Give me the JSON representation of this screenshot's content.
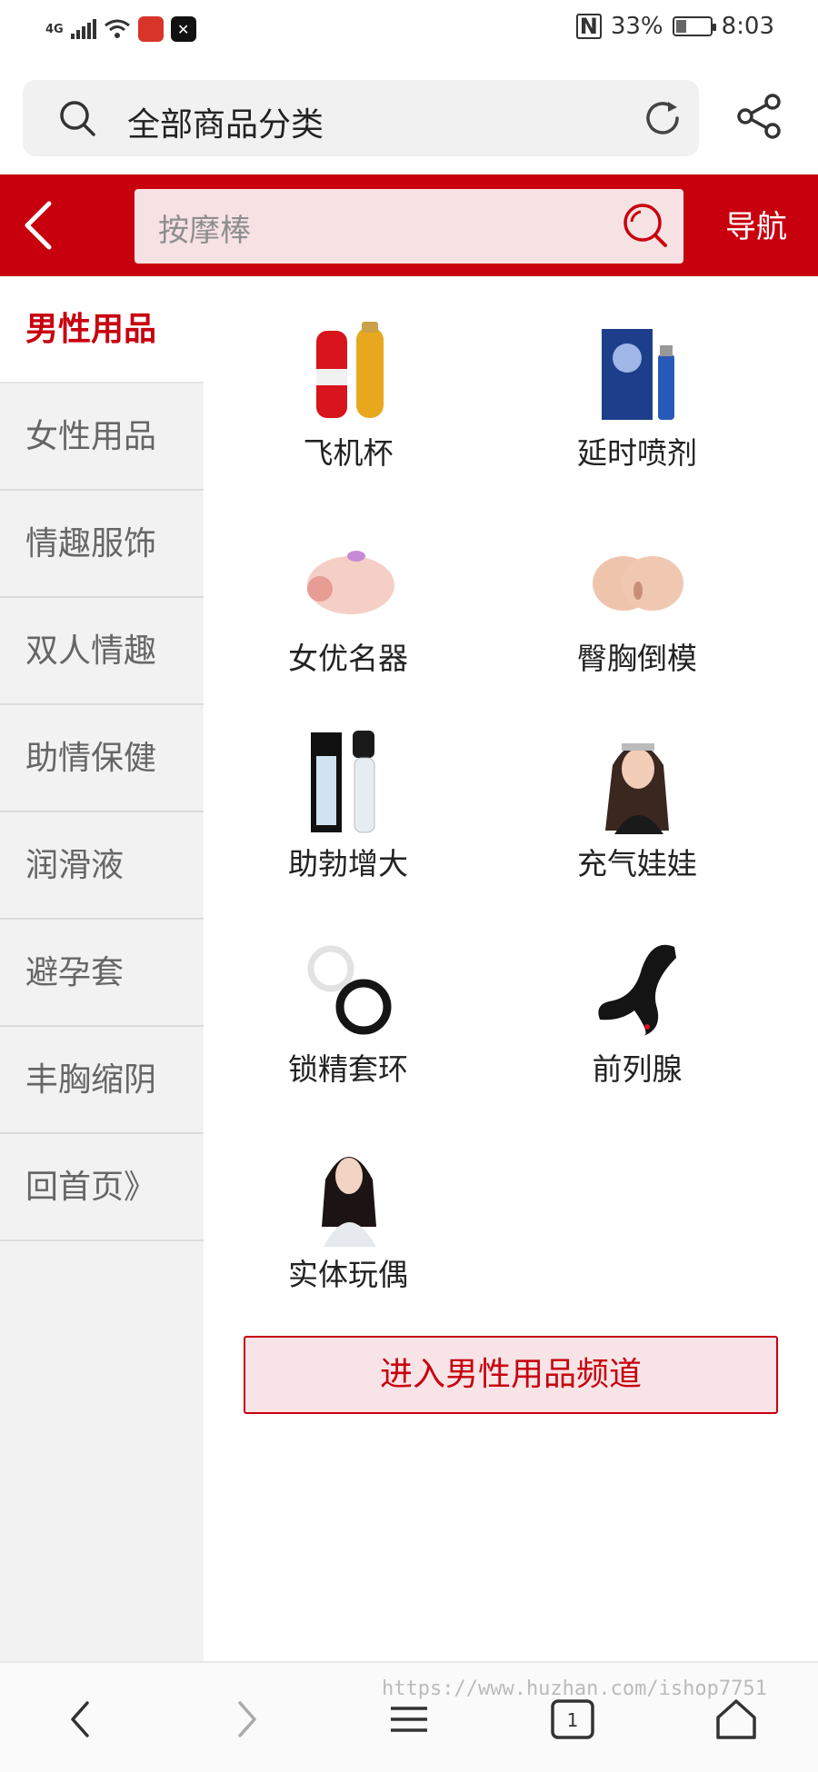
{
  "status_bar": {
    "network": "4G",
    "battery_percent": "33%",
    "battery_level": 0.33,
    "time": "8:03"
  },
  "browser": {
    "address_text": "全部商品分类"
  },
  "header": {
    "search_placeholder": "按摩棒",
    "nav_label": "导航"
  },
  "sidebar": {
    "items": [
      {
        "label": "男性用品",
        "active": true
      },
      {
        "label": "女性用品",
        "active": false
      },
      {
        "label": "情趣服饰",
        "active": false
      },
      {
        "label": "双人情趣",
        "active": false
      },
      {
        "label": "助情保健",
        "active": false
      },
      {
        "label": "润滑液",
        "active": false
      },
      {
        "label": "避孕套",
        "active": false
      },
      {
        "label": "丰胸缩阴",
        "active": false
      },
      {
        "label": "回首页》",
        "active": false
      }
    ]
  },
  "categories": [
    {
      "label": "飞机杯",
      "icon": "masturbation-cup-image"
    },
    {
      "label": "延时喷剂",
      "icon": "delay-spray-image"
    },
    {
      "label": "女优名器",
      "icon": "sleeve-toy-image"
    },
    {
      "label": "臀胸倒模",
      "icon": "mold-image"
    },
    {
      "label": "助勃增大",
      "icon": "pump-image"
    },
    {
      "label": "充气娃娃",
      "icon": "inflatable-doll-image"
    },
    {
      "label": "锁精套环",
      "icon": "ring-image"
    },
    {
      "label": "前列腺",
      "icon": "prostate-massager-image"
    },
    {
      "label": "实体玩偶",
      "icon": "doll-image"
    }
  ],
  "channel_button": "进入男性用品频道",
  "watermark": "https://www.huzhan.com/ishop7751"
}
